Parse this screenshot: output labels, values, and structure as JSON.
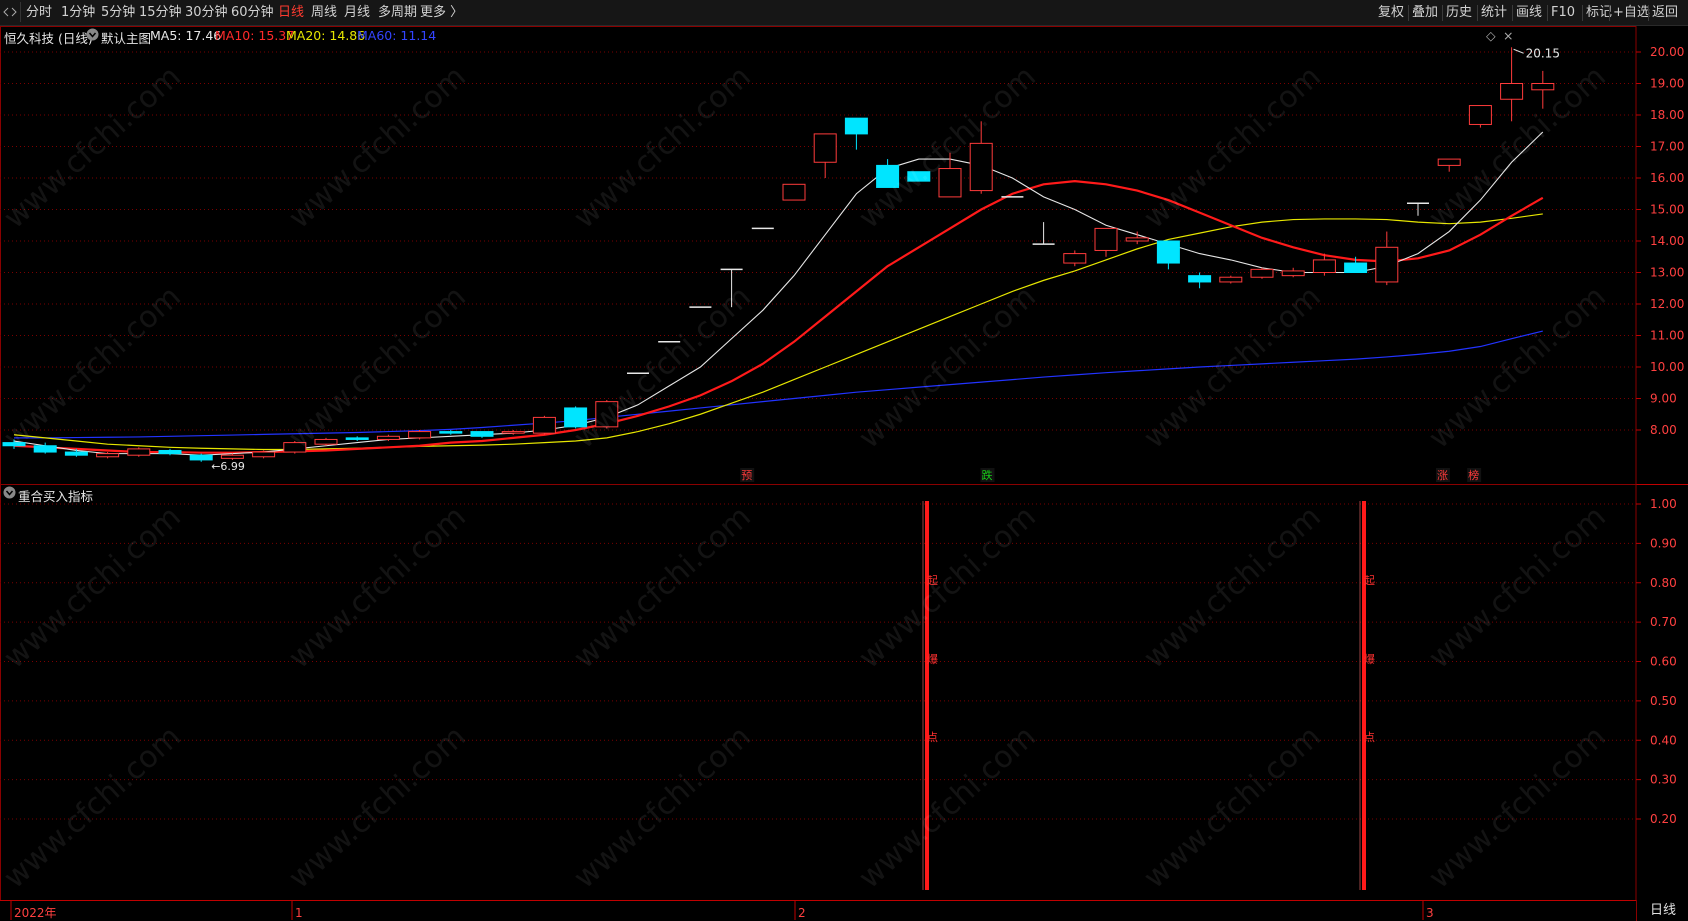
{
  "toolbar": {
    "left_items": [
      "分时",
      "1分钟",
      "5分钟",
      "15分钟",
      "30分钟",
      "60分钟",
      "日线",
      "周线",
      "月线",
      "多周期",
      "更多 〉"
    ],
    "active_item": "日线",
    "right_items": [
      "复权",
      "叠加",
      "历史",
      "统计",
      "画线",
      "F10",
      "+自选",
      "返回"
    ],
    "right_items_extra": "标记"
  },
  "main_header": {
    "stock": "恒久科技 (日线)",
    "template": "默认主图",
    "ma5": "MA5: 17.46",
    "ma10": "MA10: 15.37",
    "ma20": "MA20: 14.86",
    "ma60": "MA60: 11.14"
  },
  "colors": {
    "up": "#ff3b3b",
    "down": "#00e5ff",
    "ma5": "#e6e6e6",
    "ma10": "#ff1a1a",
    "ma20": "#e6e600",
    "ma60": "#2233ff",
    "grid": "#7a0000",
    "axis_text": "#ff4040"
  },
  "sub_header": {
    "title": "重合买入指标"
  },
  "price_axis": {
    "ticks": [
      "20.00",
      "19.00",
      "18.00",
      "17.00",
      "16.00",
      "15.00",
      "14.00",
      "13.00",
      "12.00",
      "11.00",
      "10.00",
      "9.00",
      "8.00"
    ]
  },
  "indicator_axis": {
    "ticks": [
      "1.00",
      "0.90",
      "0.80",
      "0.70",
      "0.60",
      "0.50",
      "0.40",
      "0.30",
      "0.20"
    ]
  },
  "date_axis": {
    "labels": [
      "2022年",
      "1",
      "2",
      "3"
    ]
  },
  "annotations": {
    "high": "20.15",
    "low": "6.99",
    "high_arrow": "←",
    "low_arrow": "←"
  },
  "markers": [
    "预",
    "跌",
    "涨",
    "榜"
  ],
  "signal_chars": [
    "起",
    "爆",
    "点"
  ],
  "watermark": "www.cfchi.com",
  "bottom_right": "日线",
  "chart_data": {
    "type": "candlestick",
    "candles": [
      {
        "o": 7.6,
        "c": 7.5,
        "h": 7.7,
        "l": 7.4
      },
      {
        "o": 7.5,
        "c": 7.3,
        "h": 7.6,
        "l": 7.25
      },
      {
        "o": 7.3,
        "c": 7.2,
        "h": 7.4,
        "l": 7.15
      },
      {
        "o": 7.15,
        "c": 7.25,
        "h": 7.3,
        "l": 7.1
      },
      {
        "o": 7.2,
        "c": 7.4,
        "h": 7.45,
        "l": 7.15
      },
      {
        "o": 7.35,
        "c": 7.25,
        "h": 7.4,
        "l": 7.2
      },
      {
        "o": 7.2,
        "c": 7.05,
        "h": 7.25,
        "l": 6.99
      },
      {
        "o": 7.1,
        "c": 7.2,
        "h": 7.25,
        "l": 7.05
      },
      {
        "o": 7.15,
        "c": 7.3,
        "h": 7.35,
        "l": 7.1
      },
      {
        "o": 7.3,
        "c": 7.6,
        "h": 7.65,
        "l": 7.25
      },
      {
        "o": 7.55,
        "c": 7.7,
        "h": 7.75,
        "l": 7.5
      },
      {
        "o": 7.75,
        "c": 7.7,
        "h": 7.8,
        "l": 7.65
      },
      {
        "o": 7.7,
        "c": 7.8,
        "h": 7.85,
        "l": 7.65
      },
      {
        "o": 7.75,
        "c": 7.95,
        "h": 8.0,
        "l": 7.7
      },
      {
        "o": 7.95,
        "c": 7.9,
        "h": 8.0,
        "l": 7.85
      },
      {
        "o": 7.95,
        "c": 7.8,
        "h": 7.95,
        "l": 7.75
      },
      {
        "o": 7.9,
        "c": 7.95,
        "h": 8.0,
        "l": 7.85
      },
      {
        "o": 7.9,
        "c": 8.4,
        "h": 8.45,
        "l": 7.85
      },
      {
        "o": 8.7,
        "c": 8.1,
        "h": 8.75,
        "l": 8.05
      },
      {
        "o": 8.1,
        "c": 8.9,
        "h": 8.95,
        "l": 8.05
      },
      {
        "o": 9.8,
        "c": 9.8,
        "h": 9.8,
        "l": 9.8
      },
      {
        "o": 10.8,
        "c": 10.8,
        "h": 10.8,
        "l": 10.8
      },
      {
        "o": 11.9,
        "c": 11.9,
        "h": 11.9,
        "l": 11.9
      },
      {
        "o": 13.1,
        "c": 13.1,
        "h": 13.1,
        "l": 11.9
      },
      {
        "o": 14.4,
        "c": 14.4,
        "h": 14.4,
        "l": 14.4
      },
      {
        "o": 15.3,
        "c": 15.8,
        "h": 15.8,
        "l": 15.3
      },
      {
        "o": 16.5,
        "c": 17.4,
        "h": 17.4,
        "l": 16.0
      },
      {
        "o": 17.9,
        "c": 17.4,
        "h": 17.9,
        "l": 16.9
      },
      {
        "o": 16.4,
        "c": 15.7,
        "h": 16.6,
        "l": 15.7
      },
      {
        "o": 16.2,
        "c": 15.9,
        "h": 16.2,
        "l": 15.9
      },
      {
        "o": 15.4,
        "c": 16.3,
        "h": 16.8,
        "l": 15.4
      },
      {
        "o": 15.6,
        "c": 17.1,
        "h": 17.8,
        "l": 15.5
      },
      {
        "o": 15.4,
        "c": 15.4,
        "h": 15.4,
        "l": 15.4
      },
      {
        "o": 13.9,
        "c": 13.9,
        "h": 14.6,
        "l": 13.9
      },
      {
        "o": 13.3,
        "c": 13.6,
        "h": 13.7,
        "l": 13.2
      },
      {
        "o": 13.7,
        "c": 14.4,
        "h": 14.4,
        "l": 13.5
      },
      {
        "o": 14.0,
        "c": 14.1,
        "h": 14.3,
        "l": 13.9
      },
      {
        "o": 14.0,
        "c": 13.3,
        "h": 14.0,
        "l": 13.1
      },
      {
        "o": 12.9,
        "c": 12.7,
        "h": 13.0,
        "l": 12.5
      },
      {
        "o": 12.7,
        "c": 12.85,
        "h": 12.9,
        "l": 12.65
      },
      {
        "o": 12.85,
        "c": 13.1,
        "h": 13.15,
        "l": 12.8
      },
      {
        "o": 12.9,
        "c": 13.05,
        "h": 13.15,
        "l": 12.85
      },
      {
        "o": 13.0,
        "c": 13.4,
        "h": 13.6,
        "l": 12.9
      },
      {
        "o": 13.3,
        "c": 13.0,
        "h": 13.5,
        "l": 13.0
      },
      {
        "o": 12.7,
        "c": 13.8,
        "h": 14.3,
        "l": 12.6
      },
      {
        "o": 15.2,
        "c": 15.2,
        "h": 15.2,
        "l": 14.8
      },
      {
        "o": 16.4,
        "c": 16.6,
        "h": 16.6,
        "l": 16.2
      },
      {
        "o": 17.7,
        "c": 18.3,
        "h": 18.3,
        "l": 17.6
      },
      {
        "o": 18.5,
        "c": 19.0,
        "h": 20.15,
        "l": 17.8
      },
      {
        "o": 18.8,
        "c": 19.0,
        "h": 19.4,
        "l": 18.2
      }
    ],
    "ma5": [
      7.65,
      7.5,
      7.35,
      7.25,
      7.25,
      7.25,
      7.2,
      7.25,
      7.3,
      7.4,
      7.5,
      7.6,
      7.7,
      7.75,
      7.8,
      7.85,
      7.9,
      8.0,
      8.15,
      8.4,
      8.8,
      9.4,
      10.0,
      10.9,
      11.8,
      12.9,
      14.2,
      15.5,
      16.3,
      16.6,
      16.6,
      16.4,
      16.0,
      15.4,
      15.0,
      14.5,
      14.2,
      13.9,
      13.6,
      13.4,
      13.15,
      13.0,
      13.0,
      13.0,
      13.2,
      13.6,
      14.3,
      15.3,
      16.5,
      17.46
    ],
    "ma10": [
      7.5,
      7.45,
      7.4,
      7.35,
      7.3,
      7.3,
      7.28,
      7.28,
      7.3,
      7.32,
      7.35,
      7.4,
      7.45,
      7.5,
      7.6,
      7.65,
      7.75,
      7.85,
      8.0,
      8.2,
      8.45,
      8.75,
      9.1,
      9.55,
      10.1,
      10.8,
      11.6,
      12.4,
      13.2,
      13.8,
      14.4,
      15.0,
      15.5,
      15.8,
      15.9,
      15.8,
      15.6,
      15.3,
      14.9,
      14.5,
      14.1,
      13.8,
      13.55,
      13.4,
      13.35,
      13.45,
      13.7,
      14.2,
      14.8,
      15.37
    ],
    "ma20": [
      7.85,
      7.75,
      7.65,
      7.55,
      7.5,
      7.45,
      7.42,
      7.4,
      7.38,
      7.38,
      7.4,
      7.42,
      7.45,
      7.48,
      7.5,
      7.52,
      7.55,
      7.6,
      7.65,
      7.75,
      7.95,
      8.2,
      8.5,
      8.85,
      9.2,
      9.6,
      10.0,
      10.4,
      10.8,
      11.2,
      11.6,
      12.0,
      12.4,
      12.75,
      13.05,
      13.4,
      13.75,
      14.05,
      14.25,
      14.45,
      14.6,
      14.68,
      14.7,
      14.7,
      14.68,
      14.6,
      14.55,
      14.6,
      14.72,
      14.86
    ],
    "ma60": [
      7.75,
      7.75,
      7.76,
      7.77,
      7.78,
      7.8,
      7.82,
      7.84,
      7.86,
      7.88,
      7.9,
      7.92,
      7.95,
      7.98,
      8.02,
      8.08,
      8.15,
      8.22,
      8.3,
      8.4,
      8.5,
      8.6,
      8.7,
      8.8,
      8.9,
      9.0,
      9.1,
      9.2,
      9.28,
      9.36,
      9.44,
      9.52,
      9.6,
      9.68,
      9.75,
      9.82,
      9.88,
      9.94,
      10.0,
      10.05,
      10.1,
      10.15,
      10.2,
      10.25,
      10.32,
      10.4,
      10.5,
      10.65,
      10.9,
      11.14
    ],
    "indicator": {
      "signals_at": [
        29,
        43
      ],
      "value": 1.0
    }
  }
}
